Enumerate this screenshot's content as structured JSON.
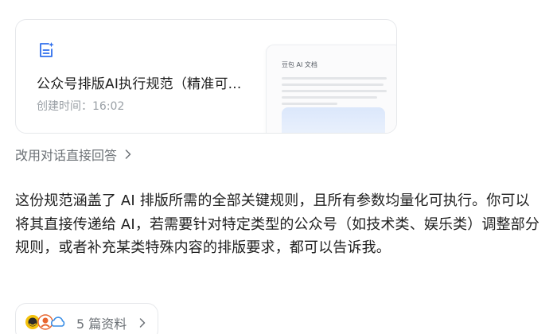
{
  "doc_card": {
    "title": "公众号排版AI执行规范（精准可...",
    "created_label": "创建时间：16:02",
    "preview": {
      "title": "豆包 AI 文档"
    }
  },
  "switch_link": {
    "label": "改用对话直接回答"
  },
  "answer": {
    "text": "这份规范涵盖了 AI 排版所需的全部关键规则，且所有参数均量化可执行。你可以将其直接传递给 AI，若需要针对特定类型的公众号（如技术类、娱乐类）调整部分规则，或者补充某类特殊内容的排版要求，都可以告诉我。"
  },
  "references": {
    "label": "5 篇资料",
    "icons": [
      "sohu-icon",
      "qq-icon",
      "cloud-icon"
    ]
  },
  "colors": {
    "accent": "#2f6fed",
    "muted_text": "#6b7075",
    "meta_text": "#9aa0a6",
    "border": "#e6e8eb"
  }
}
